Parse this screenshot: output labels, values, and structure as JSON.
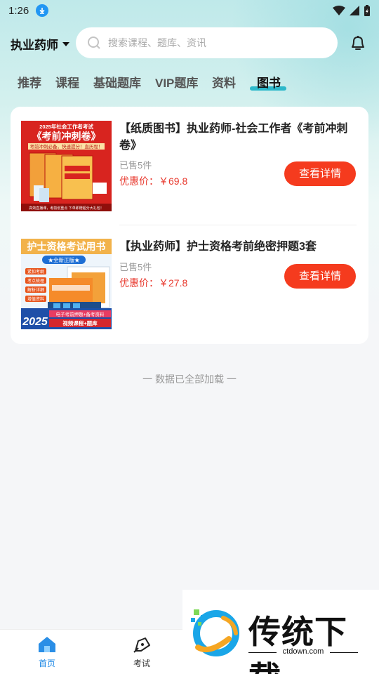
{
  "status_bar": {
    "time": "1:26"
  },
  "header": {
    "city": "执业药师",
    "search_placeholder": "搜索课程、题库、资讯"
  },
  "tabs": [
    {
      "label": "推荐"
    },
    {
      "label": "课程"
    },
    {
      "label": "基础题库"
    },
    {
      "label": "VIP题库"
    },
    {
      "label": "资料"
    },
    {
      "label": "图书",
      "active": true
    }
  ],
  "products": [
    {
      "title": "【纸质图书】执业药师-社会工作者《考前冲刺卷》",
      "sold": "已售5件",
      "price": "优惠价：￥69.8",
      "button": "查看详情",
      "cover": {
        "year_line": "2025年社会工作者考试",
        "book_name": "《考前冲刺卷》",
        "slogan": "考前冲刺必备，快速提分！直历程！",
        "footer": "高效直播课，考前划重点  下单即赠超分大礼包！"
      }
    },
    {
      "title": "【执业药师】护士资格考前绝密押题3套",
      "sold": "已售5件",
      "price": "优惠价：￥27.8",
      "button": "查看详情",
      "cover": {
        "headline": "护士资格考试用书",
        "badge": "★全新正版★",
        "tags": [
          "紧扣考纲",
          "考点梳理",
          "解析详细",
          "增值资料"
        ],
        "year": "2025",
        "footer_line1": "电子考前押题+备考资料",
        "footer_line2": "视频课程+题库"
      }
    }
  ],
  "end_note": "一  数据已全部加载  一",
  "bottom_nav": [
    {
      "label": "首页",
      "active": true
    },
    {
      "label": "考试"
    }
  ],
  "watermark": {
    "title": "传统下载",
    "sub": "ctdown.com"
  },
  "colors": {
    "accent": "#f53b1e",
    "price": "#e83a2f",
    "tab_indicator": "#1bb3c6",
    "nav_active": "#1e88e5"
  }
}
